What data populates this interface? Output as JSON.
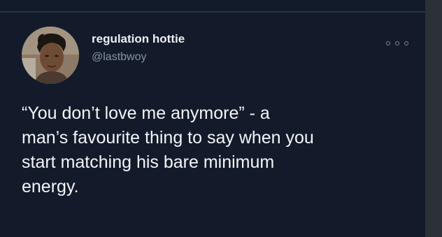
{
  "tweet": {
    "author": {
      "display_name": "regulation hottie",
      "handle": "@lastbwoy",
      "avatar_icon": "profile-photo"
    },
    "more_icon": "more-horizontal-icon",
    "text_lines": [
      "“You don’t love me anymore” - a",
      "man’s favourite thing to say when you",
      "start matching his bare minimum",
      "energy."
    ]
  },
  "colors": {
    "card_background": "#131b2a",
    "text_primary": "#f3f5f8",
    "text_secondary": "#8a93a3"
  }
}
